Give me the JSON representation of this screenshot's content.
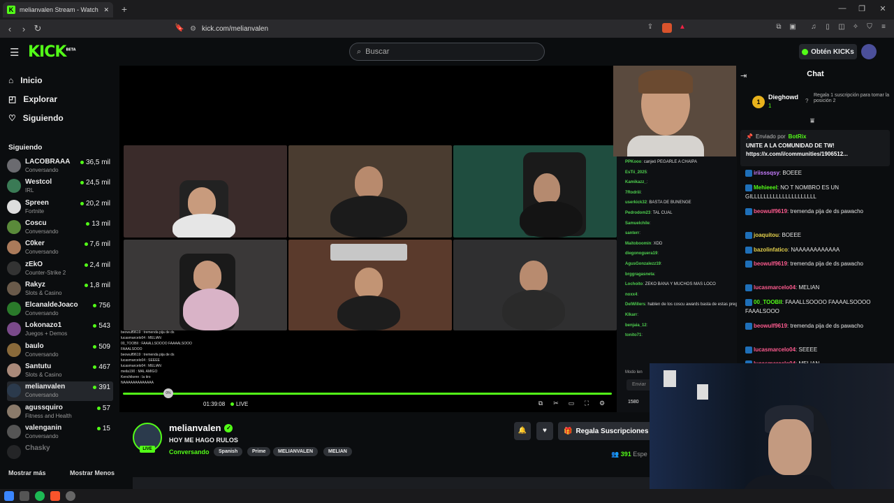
{
  "browser": {
    "tab_title": "melianvalen Stream - Watch",
    "tab_close": "✕",
    "new_tab": "+",
    "url": "kick.com/melianvalen",
    "window_controls": [
      "—",
      "❐",
      "✕"
    ]
  },
  "header": {
    "logo": "KICK",
    "logo_sup": "BETA",
    "search_placeholder": "Buscar",
    "kicks_button": "Obtén KICKs"
  },
  "sidebar": {
    "nav": [
      {
        "label": "Inicio",
        "icon": "home-icon"
      },
      {
        "label": "Explorar",
        "icon": "compass-icon"
      },
      {
        "label": "Siguiendo",
        "icon": "heart-icon"
      }
    ],
    "following_header": "Siguiendo",
    "channels": [
      {
        "name": "LACOBRAAA",
        "category": "Conversando",
        "viewers": "36,5 mil"
      },
      {
        "name": "Westcol",
        "category": "IRL",
        "viewers": "24,5 mil"
      },
      {
        "name": "Spreen",
        "category": "Fortnite",
        "viewers": "20,2 mil"
      },
      {
        "name": "Coscu",
        "category": "Conversando",
        "viewers": "13 mil"
      },
      {
        "name": "C0ker",
        "category": "Conversando",
        "viewers": "7,6 mil"
      },
      {
        "name": "zEkO",
        "category": "Counter-Strike 2",
        "viewers": "2,4 mil"
      },
      {
        "name": "Rakyz",
        "category": "Slots & Casino",
        "viewers": "1,8 mil"
      },
      {
        "name": "ElcanaldeJoaco",
        "category": "Conversando",
        "viewers": "756"
      },
      {
        "name": "Lokonazo1",
        "category": "Juegos + Demos",
        "viewers": "543"
      },
      {
        "name": "baulo",
        "category": "Conversando",
        "viewers": "509"
      },
      {
        "name": "Santutu",
        "category": "Slots & Casino",
        "viewers": "467"
      },
      {
        "name": "melianvalen",
        "category": "Conversando",
        "viewers": "391"
      },
      {
        "name": "agussquiro",
        "category": "Fitness and Health",
        "viewers": "57"
      },
      {
        "name": "valenganin",
        "category": "Conversando",
        "viewers": "15"
      },
      {
        "name": "Chasky",
        "category": "",
        "viewers": ""
      }
    ],
    "show_more": "Mostrar más",
    "show_less": "Mostrar Menos"
  },
  "player": {
    "time": "01:39:08",
    "live": "LIVE",
    "volume_percent": "0%",
    "progress": 1.0,
    "overlay_chat": [
      "beowulf9619 : tremenda pija de ds",
      "lucasmarcelo04 : MELIAN",
      "00_TOOBII : FAAALLSOOOO FAAAALSOOO",
      "FAAALSOOO",
      "beowulf9619 : tremenda pija de ds",
      "lucasmarcelo04 : SEEEE",
      "lucasmarcelo04 : MELIAN",
      "meila190 : MAL AMIGO",
      "Kenchikenn : la tiro",
      "NAAAAAAAAAAAAA"
    ],
    "embedded_chat": [
      {
        "user": "PPKooo",
        "text": "canjeó PEGARLE A CHAIPA"
      },
      {
        "user": "EsTii_2025",
        "text": ""
      },
      {
        "user": "Kamikazz_",
        "text": ""
      },
      {
        "user": "7Rodriii",
        "text": ""
      },
      {
        "user": "userkick32",
        "text": "BASTA DE BUNENGE"
      },
      {
        "user": "Pedrodom23",
        "text": "TAL CUAL"
      },
      {
        "user": "Samuelchile",
        "text": ""
      },
      {
        "user": "santerr",
        "text": ""
      },
      {
        "user": "Maitoboomin",
        "text": "XDD"
      },
      {
        "user": "diegonoguera19",
        "text": ""
      },
      {
        "user": "AgusGonzalezz19",
        "text": ""
      },
      {
        "user": "brggragasneta",
        "text": ""
      },
      {
        "user": "Lochoito",
        "text": "ZEKO BANA Y MUCHOS MAS LOCO"
      },
      {
        "user": "noxx4",
        "text": ""
      },
      {
        "user": "DelWillers",
        "text": "hablen de los coscu awards basta de estas preguntas al pedo"
      },
      {
        "user": "KIkarr",
        "text": ""
      },
      {
        "user": "benjaia_12",
        "text": ""
      },
      {
        "user": "tonito71",
        "text": ""
      }
    ],
    "embedded_mode": "Modo len",
    "embedded_send": "Enviar",
    "embedded_count": "1580"
  },
  "stream": {
    "channel": "melianvalen",
    "title": "HOY ME HAGO RULOS",
    "category": "Conversando",
    "live_badge": "LIVE",
    "tags": [
      "Spanish",
      "Prime",
      "MELIANVALEN",
      "MELIAN"
    ],
    "gift_button": "Regala Suscripciones",
    "viewers": "391",
    "viewers_label": "Espe"
  },
  "chat": {
    "title": "Chat",
    "top_gifter": {
      "name": "Dieghowd",
      "rank": "1",
      "count": "1",
      "cta": "Regala 1 suscripción para tomar la posición 2"
    },
    "pinned": {
      "sender_prefix": "Enviado por",
      "sender": "BotRix",
      "text": "UNITE A LA COMUNIDAD DE TW!",
      "link": "https://x.com/i/communities/1906512..."
    },
    "messages": [
      {
        "user": "iriisssqsy",
        "text": "BOEEE",
        "color": "#c77dff"
      },
      {
        "user": "Mehieeel",
        "text": "NO T NOMBRO ES UN GILLLLLLLLLLLLLLLLLLLLL",
        "color": "#53fc18"
      },
      {
        "user": "beowulf9619",
        "text": "tremenda pija de ds pawacho",
        "color": "#ff5b8f"
      },
      {
        "user": "joaquitou",
        "text": "BOEEE",
        "color": "#e8d44d"
      },
      {
        "user": "bazolinfatico",
        "text": "NAAAAAAAAAAAA",
        "color": "#e8d44d"
      },
      {
        "user": "beowulf9619",
        "text": "tremenda pija de ds pawacho",
        "color": "#ff5b8f"
      },
      {
        "user": "lucasmarcelo04",
        "text": "MELIAN",
        "color": "#ff5b8f"
      },
      {
        "user": "00_TOOBII",
        "text": "FAAALLSOOOO FAAAALSOOOO FAAALSOOO",
        "color": "#53fc18"
      },
      {
        "user": "beowulf9619",
        "text": "tremenda pija de ds pawacho",
        "color": "#ff5b8f"
      },
      {
        "user": "lucasmarcelo04",
        "text": "SEEEE",
        "color": "#ff5b8f"
      },
      {
        "user": "lucasmarcelo04",
        "text": "MELIAN",
        "color": "#ff5b8f"
      }
    ]
  },
  "colors": {
    "accent": "#53fc18",
    "bg": "#0b0d0f",
    "panel": "#24272c"
  }
}
